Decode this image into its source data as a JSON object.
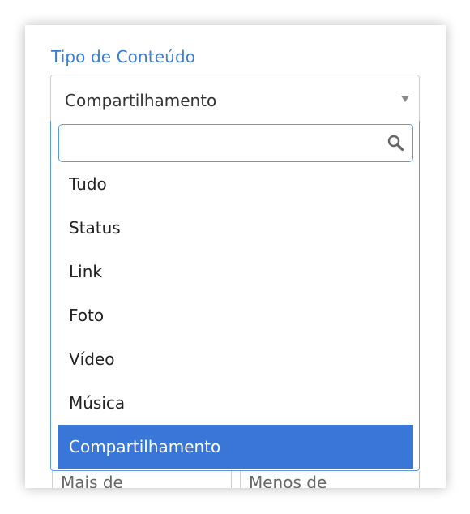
{
  "field": {
    "label": "Tipo de Conteúdo",
    "selected_value": "Compartilhamento"
  },
  "search": {
    "value": "",
    "placeholder": ""
  },
  "options": [
    {
      "label": "Tudo",
      "selected": false
    },
    {
      "label": "Status",
      "selected": false
    },
    {
      "label": "Link",
      "selected": false
    },
    {
      "label": "Foto",
      "selected": false
    },
    {
      "label": "Vídeo",
      "selected": false
    },
    {
      "label": "Música",
      "selected": false
    },
    {
      "label": "Compartilhamento",
      "selected": true
    }
  ],
  "bottom_fields": {
    "left_label": "Mais de",
    "right_label": "Menos de"
  },
  "colors": {
    "accent": "#3a7bd5",
    "selected_bg": "#3a76d8",
    "focus_border": "#5a9be8"
  },
  "icons": {
    "search": "search-icon",
    "dropdown_arrow": "caret-down-icon"
  }
}
